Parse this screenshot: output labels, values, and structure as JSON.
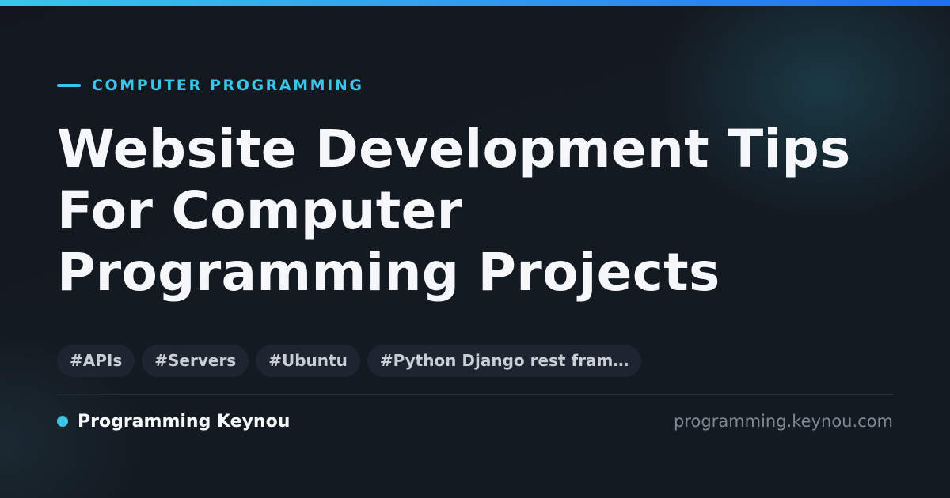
{
  "category": "COMPUTER PROGRAMMING",
  "title_lines": [
    "Website Development Tips",
    "For Computer",
    "Programming Projects"
  ],
  "tags": [
    "#APIs",
    "#Servers",
    "#Ubuntu",
    "#Python Django rest fram…"
  ],
  "brand": {
    "name": "Programming Keynou",
    "url": "programming.keynou.com"
  },
  "colors": {
    "accent": "#39c6ea",
    "background": "#141a22",
    "tag_background": "#1d2630",
    "title_text": "#f5f7fa",
    "muted_text": "#7f8792"
  }
}
